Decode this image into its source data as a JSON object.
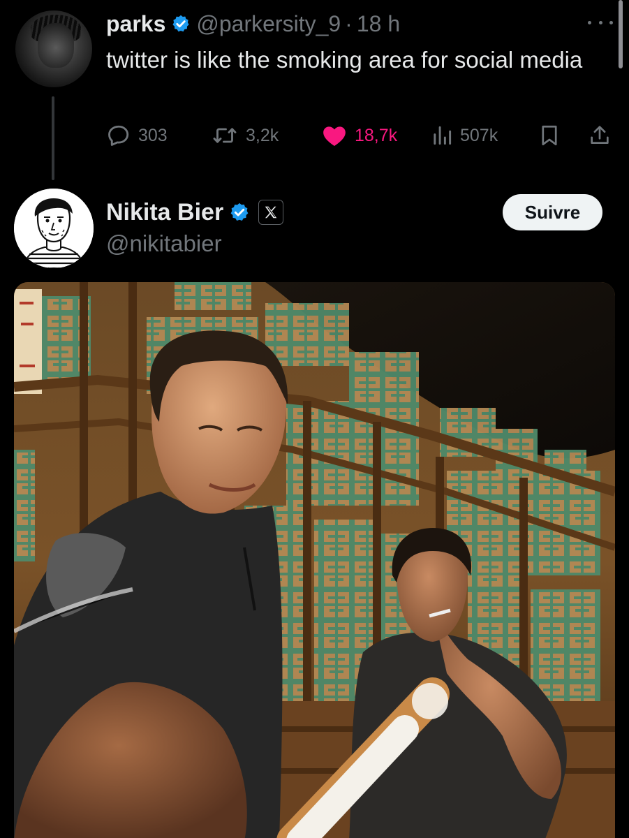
{
  "tweet1": {
    "display_name": "parks",
    "handle": "@parkersity_9",
    "separator": "·",
    "time": "18 h",
    "text": "twitter is like the smoking area for social media",
    "stats": {
      "replies": "303",
      "retweets": "3,2k",
      "likes": "18,7k",
      "views": "507k"
    }
  },
  "tweet2": {
    "display_name": "Nikita Bier",
    "handle": "@nikitabier",
    "follow_label": "Suivre"
  },
  "colors": {
    "background": "#000000",
    "text": "#e7e9ea",
    "muted": "#71767b",
    "like": "#f91880",
    "verified": "#1d9bf0",
    "follow_bg": "#eff3f4"
  },
  "icons": {
    "verified": "verified-badge-icon",
    "more": "more-icon",
    "reply": "reply-icon",
    "retweet": "retweet-icon",
    "like": "heart-icon",
    "views": "views-icon",
    "bookmark": "bookmark-icon",
    "share": "share-icon",
    "affiliate": "x-logo-icon"
  }
}
